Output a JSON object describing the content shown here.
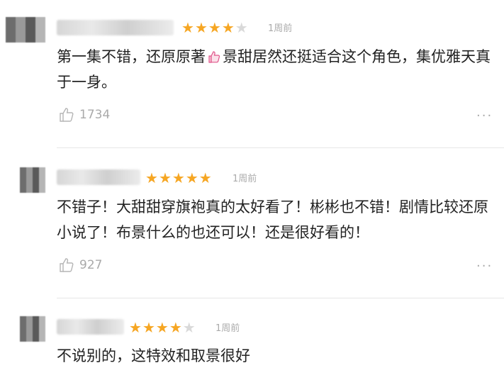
{
  "comments": [
    {
      "rating": 4,
      "time": "1周前",
      "text_before": "第一集不错，还原原著",
      "emoji": "thumbs-up-emoji",
      "text_after": "景甜居然还挺适合这个角色，集优雅天真于一身。",
      "likes": "1734"
    },
    {
      "rating": 5,
      "time": "1周前",
      "text": "不错子！大甜甜穿旗袍真的太好看了！彬彬也不错！剧情比较还原小说了！布景什么的也还可以！还是很好看的！",
      "likes": "927"
    },
    {
      "rating": 4,
      "time": "1周前",
      "text": "不说别的，这特效和取景很好"
    }
  ],
  "icons": {
    "star_filled": "★",
    "star_empty": "★",
    "more": "···"
  },
  "colors": {
    "star": "#f6a623",
    "star_empty": "#d9d9d9",
    "meta_text": "#aaaaaa"
  }
}
